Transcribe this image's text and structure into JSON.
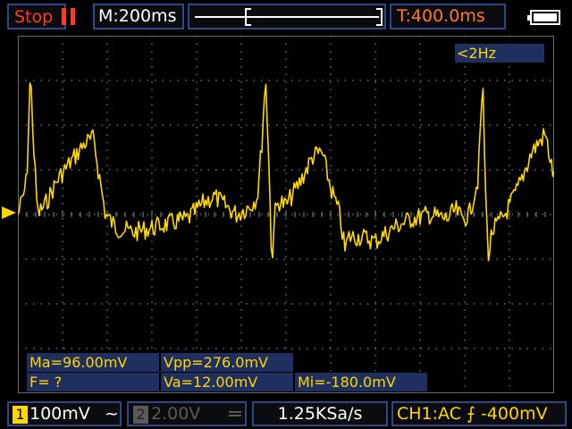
{
  "header": {
    "run_state": "Stop",
    "main_timebase": "M:200ms",
    "trigger_time": "T:400.0ms"
  },
  "frequency_readout": "<2Hz",
  "measurements": {
    "max": "Ma=96.00mV",
    "vpp": "Vpp=276.0mV",
    "freq": "F=   ?",
    "avg": "Va=12.00mV",
    "min": "Mi=-180.0mV"
  },
  "footer": {
    "ch1_number": "1",
    "ch1_scale": "100mV",
    "ch1_coupling": "~",
    "ch2_number": "2",
    "ch2_scale": "2.00V",
    "sample_rate": "1.25KSa/s",
    "trigger_info": "CH1:AC ⨍  -400mV"
  },
  "colors": {
    "trace": "#ffd700",
    "stop_red": "#ff3b1f",
    "trigger_orange": "#ff7a2a",
    "panel_blue": "#1f2f5f"
  }
}
